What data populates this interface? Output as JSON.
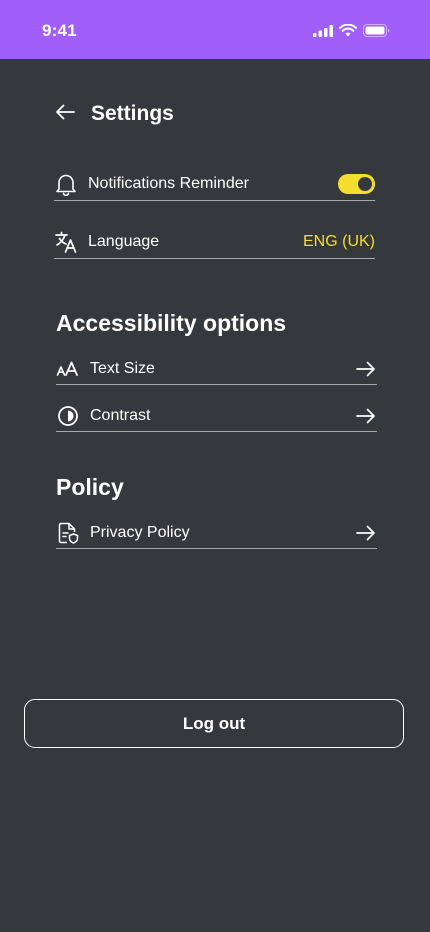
{
  "status_bar": {
    "time": "9:41",
    "background": "#a15ef8",
    "icons": [
      "cellular-signal-icon",
      "wifi-icon",
      "battery-icon"
    ]
  },
  "header": {
    "title": "Settings",
    "back_icon": "arrow-left-icon"
  },
  "general": {
    "notifications": {
      "label": "Notifications Reminder",
      "icon": "bell-icon",
      "toggle_on": true
    },
    "language": {
      "label": "Language",
      "icon": "translate-icon",
      "value": "ENG (UK)"
    }
  },
  "accessibility": {
    "title": "Accessibility options",
    "items": [
      {
        "label": "Text Size",
        "icon": "text-size-icon",
        "action_icon": "arrow-right-icon"
      },
      {
        "label": "Contrast",
        "icon": "contrast-icon",
        "action_icon": "arrow-right-icon"
      }
    ]
  },
  "policy": {
    "title": "Policy",
    "items": [
      {
        "label": "Privacy Policy",
        "icon": "privacy-document-icon",
        "action_icon": "arrow-right-icon"
      }
    ]
  },
  "logout": {
    "label": "Log out"
  },
  "colors": {
    "background": "#35383d",
    "accent": "#f3de2c",
    "status_bar": "#a15ef8",
    "divider": "#a6a8ab"
  }
}
